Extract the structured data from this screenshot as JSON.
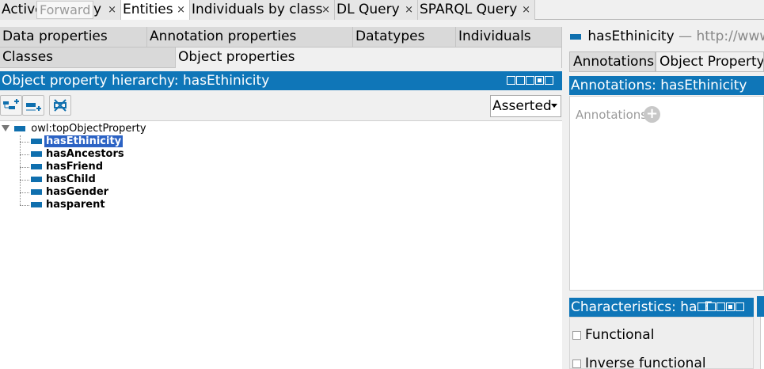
{
  "top_tabs": [
    {
      "label": "Active",
      "active": false
    },
    {
      "label": "Entities",
      "active": true
    },
    {
      "label": "Individuals by class",
      "active": false
    },
    {
      "label": "DL Query",
      "active": false
    },
    {
      "label": "SPARQL Query",
      "active": false
    }
  ],
  "tab_close_glyph": "×",
  "tooltip": "Forward",
  "tab_partial_char": "y",
  "sub_tabs_row1": [
    "Data properties",
    "Annotation properties",
    "Datatypes",
    "Individuals"
  ],
  "sub_tabs_row2": [
    "Classes",
    "Object properties"
  ],
  "hierarchy": {
    "title": "Object property hierarchy: hasEthinicity",
    "mode": "Asserted",
    "root": "owl:topObjectProperty",
    "items": [
      {
        "label": "hasEthinicity",
        "selected": true
      },
      {
        "label": "hasAncestors",
        "selected": false
      },
      {
        "label": "hasFriend",
        "selected": false
      },
      {
        "label": "hasChild",
        "selected": false
      },
      {
        "label": "hasGender",
        "selected": false
      },
      {
        "label": "hasparent",
        "selected": false
      }
    ]
  },
  "right": {
    "title": "hasEthinicity",
    "title_suffix": "— http://www.s",
    "tabs": [
      "Annotations",
      "Object Property"
    ],
    "annotations_header": "Annotations: hasEthinicity",
    "annotations_label": "Annotations",
    "characteristics_header": "Characteristics: hasE",
    "characteristics": [
      "Functional",
      "Inverse functional"
    ]
  },
  "colors": {
    "accent": "#0f76b8",
    "selection": "#2b62c4"
  }
}
